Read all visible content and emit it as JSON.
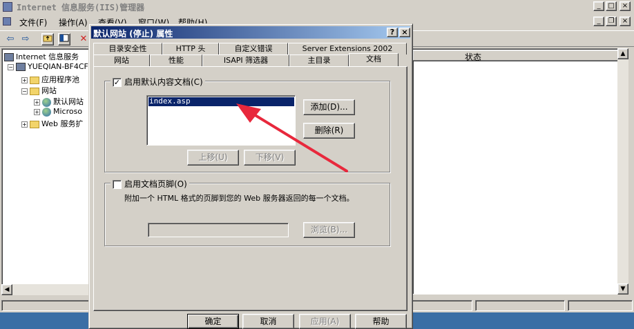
{
  "main_window": {
    "title": "Internet 信息服务(IIS)管理器",
    "caption_min": "_",
    "caption_max": "□",
    "caption_close": "×",
    "doc_min": "_",
    "doc_restore": "❐",
    "doc_close": "×"
  },
  "menu": {
    "file": "文件(F)",
    "action": "操作(A)",
    "view": "查看(V)",
    "window": "窗口(W)",
    "help": "帮助(H)"
  },
  "toolbar": {
    "back_icon": "⇦",
    "forward_icon": "⇨"
  },
  "tree": {
    "root": "Internet 信息服务",
    "server": "YUEQIAN-BF4CF7",
    "app_pools": "应用程序池",
    "websites": "网站",
    "default_site": "默认网站",
    "microsoft_site": "Microso",
    "web_ext": "Web 服务扩"
  },
  "list": {
    "status_header": "状态"
  },
  "dialog": {
    "title": "默认网站 (停止) 属性",
    "help_btn": "?",
    "close_btn": "×",
    "tabs_row1": [
      "目录安全性",
      "HTTP 头",
      "自定义错误",
      "Server Extensions 2002"
    ],
    "tabs_row2": [
      "网站",
      "性能",
      "ISAPI 筛选器",
      "主目录",
      "文档"
    ],
    "active_tab": "文档",
    "default_doc_group": {
      "checkbox_label": "启用默认内容文档(C)",
      "checked": true,
      "check_mark": "✓",
      "documents": [
        "index.asp"
      ],
      "add_button": "添加(D)...",
      "remove_button": "删除(R)",
      "move_up_button": "上移(U)",
      "move_down_button": "下移(V)"
    },
    "footer_group": {
      "checkbox_label": "启用文档页脚(O)",
      "checked": false,
      "description": "附加一个 HTML 格式的页脚到您的 Web 服务器返回的每一个文档。",
      "path_value": "",
      "browse_button": "浏览(B)..."
    },
    "buttons": {
      "ok": "确定",
      "cancel": "取消",
      "apply": "应用(A)",
      "help": "帮助"
    }
  },
  "annotation_color": "#e8283c"
}
